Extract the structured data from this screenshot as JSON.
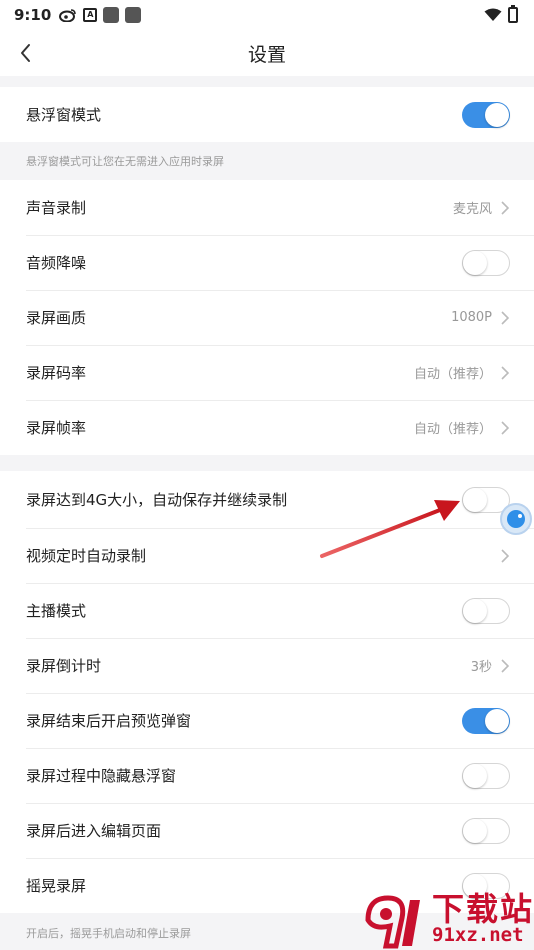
{
  "status_bar": {
    "time": "9:10",
    "a_icon_text": "A"
  },
  "header": {
    "title": "设置"
  },
  "sections": {
    "floating": {
      "label": "悬浮窗模式",
      "on": true,
      "hint": "悬浮窗模式可让您在无需进入应用时录屏"
    },
    "audio": {
      "sound_record": {
        "label": "声音录制",
        "value": "麦克风"
      },
      "noise": {
        "label": "音频降噪",
        "on": false
      },
      "quality": {
        "label": "录屏画质",
        "value": "1080P"
      },
      "bitrate": {
        "label": "录屏码率",
        "value": "自动（推荐）"
      },
      "framerate": {
        "label": "录屏帧率",
        "value": "自动（推荐）"
      }
    },
    "advanced": {
      "auto_save_4g": {
        "label": "录屏达到4G大小，自动保存并继续录制",
        "on": false
      },
      "timed": {
        "label": "视频定时自动录制"
      },
      "streamer": {
        "label": "主播模式",
        "on": false
      },
      "countdown": {
        "label": "录屏倒计时",
        "value": "3秒"
      },
      "preview_popup": {
        "label": "录屏结束后开启预览弹窗",
        "on": true
      },
      "hide_float": {
        "label": "录屏过程中隐藏悬浮窗",
        "on": false
      },
      "edit_page": {
        "label": "录屏后进入编辑页面",
        "on": false
      },
      "shake": {
        "label": "摇晃录屏",
        "on": false,
        "hint": "开启后，摇晃手机启动和停止录屏"
      }
    }
  },
  "watermark": {
    "text": "下载站",
    "url": "91xz.net"
  },
  "colors": {
    "accent": "#3a8fe6",
    "arrow": "#d9232e",
    "watermark": "#c8102e"
  }
}
